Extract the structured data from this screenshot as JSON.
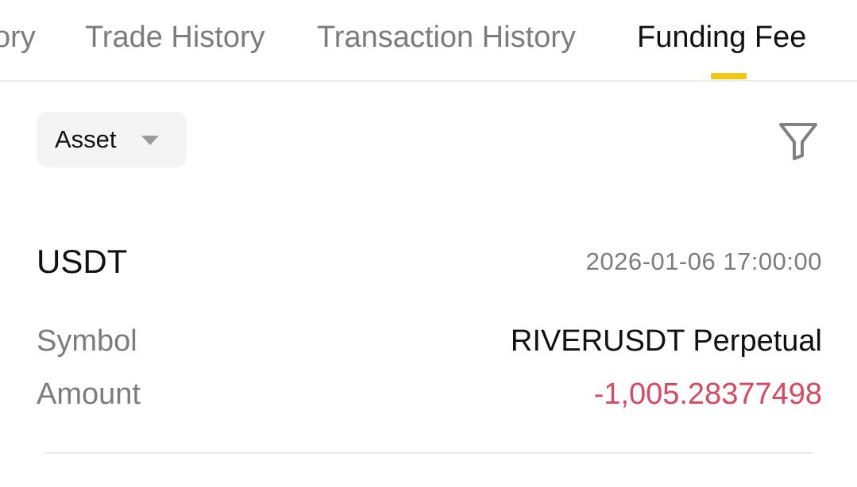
{
  "tabs": [
    {
      "label": "ory",
      "active": false
    },
    {
      "label": "Trade History",
      "active": false
    },
    {
      "label": "Transaction History",
      "active": false
    },
    {
      "label": "Funding Fee",
      "active": true
    }
  ],
  "filters": {
    "asset_label": "Asset",
    "asset_icon": "caret-down-icon",
    "filter_icon": "funnel-icon"
  },
  "record": {
    "coin": "USDT",
    "timestamp": "2026-01-06 17:00:00",
    "symbol_label": "Symbol",
    "symbol_value": "RIVERUSDT Perpetual",
    "amount_label": "Amount",
    "amount_value": "-1,005.28377498"
  },
  "colors": {
    "accent": "#f0c714",
    "negative": "#d9485f",
    "muted_text": "#7c7c7c",
    "primary_text": "#111111"
  }
}
